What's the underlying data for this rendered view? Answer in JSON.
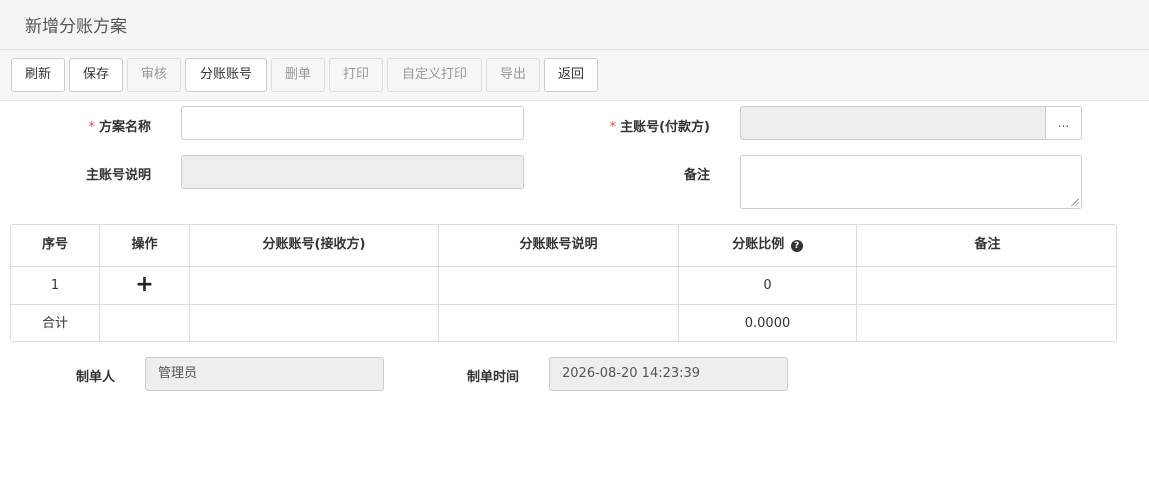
{
  "page": {
    "title": "新增分账方案"
  },
  "toolbar": {
    "refresh": "刷新",
    "save": "保存",
    "audit": "审核",
    "split_account": "分账账号",
    "delete": "删单",
    "print": "打印",
    "custom_print": "自定义打印",
    "export": "导出",
    "back": "返回"
  },
  "form": {
    "required_mark": "*",
    "scheme_name_label": "方案名称",
    "scheme_name_value": "",
    "main_account_label": "主账号(付款方)",
    "main_account_value": "",
    "main_account_button": "...",
    "main_account_desc_label": "主账号说明",
    "main_account_desc_value": "",
    "remark_label": "备注",
    "remark_value": ""
  },
  "grid": {
    "headers": {
      "seq": "序号",
      "action": "操作",
      "split_account": "分账账号(接收方)",
      "split_account_desc": "分账账号说明",
      "ratio": "分账比例",
      "ratio_help_icon": "question-circle-icon",
      "remark": "备注"
    },
    "rows": [
      {
        "seq": "1",
        "action_icon": "plus-icon",
        "action_glyph": "+",
        "split_account": "",
        "split_account_desc": "",
        "ratio": "0",
        "remark": ""
      }
    ],
    "total": {
      "label": "合计",
      "ratio": "0.0000"
    }
  },
  "footer": {
    "creator_label": "制单人",
    "creator_value": "管理员",
    "create_time_label": "制单时间",
    "create_time_value": "2026-08-20 14:23:39"
  }
}
